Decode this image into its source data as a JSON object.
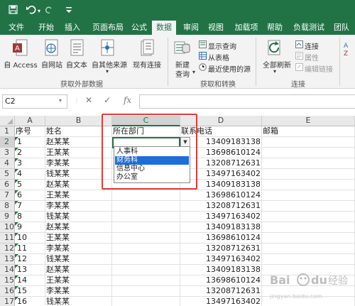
{
  "titlebar": {
    "save_icon": "save-icon",
    "undo_icon": "undo-icon",
    "customize_icon": "customize-qat-icon"
  },
  "tabs": [
    "文件",
    "开始",
    "插入",
    "页面布局",
    "公式",
    "数据",
    "审阅",
    "视图",
    "加载项",
    "帮助",
    "负载测试",
    "团队"
  ],
  "active_tab": "数据",
  "ribbon": {
    "external": {
      "access": "自 Access",
      "web": "自网站",
      "text": "自文本",
      "other": "自其他来源",
      "existing": "现有连接",
      "label": "获取外部数据"
    },
    "transform": {
      "new_query_1": "新建",
      "new_query_2": "查询",
      "show_queries": "显示查询",
      "from_table": "从表格",
      "recent_sources": "最近使用的源",
      "label": "获取和转换"
    },
    "connections": {
      "refresh_all": "全部刷新",
      "connections": "连接",
      "properties": "属性",
      "edit_links": "编辑链接",
      "label": "连接"
    }
  },
  "formula_bar": {
    "name_box": "C2",
    "cancel": "✕",
    "enter": "✓",
    "fx": "fx",
    "value": ""
  },
  "columns": [
    "A",
    "B",
    "C",
    "D",
    "E"
  ],
  "header_row": [
    "序号",
    "姓名",
    "所在部门",
    "联系电话",
    "邮箱"
  ],
  "rows": [
    [
      "1",
      "赵某某",
      "",
      "13409183138",
      ""
    ],
    [
      "2",
      "王某某",
      "",
      "13698610124",
      ""
    ],
    [
      "3",
      "李某某",
      "",
      "13208712631",
      ""
    ],
    [
      "4",
      "钱某某",
      "",
      "13497163402",
      ""
    ],
    [
      "5",
      "赵某某",
      "",
      "13409183138",
      ""
    ],
    [
      "6",
      "王某某",
      "",
      "13698610124",
      ""
    ],
    [
      "7",
      "李某某",
      "",
      "13208712631",
      ""
    ],
    [
      "8",
      "钱某某",
      "",
      "13497163402",
      ""
    ],
    [
      "9",
      "赵某某",
      "",
      "13409183138",
      ""
    ],
    [
      "10",
      "王某某",
      "",
      "13698610124",
      ""
    ],
    [
      "11",
      "李某某",
      "",
      "13208712631",
      ""
    ],
    [
      "12",
      "钱某某",
      "",
      "13497163402",
      ""
    ],
    [
      "13",
      "赵某某",
      "",
      "13409183138",
      ""
    ],
    [
      "14",
      "王某某",
      "",
      "13698610124",
      ""
    ],
    [
      "15",
      "李某某",
      "",
      "13208712631",
      ""
    ],
    [
      "16",
      "钱某某",
      "",
      "13497163402",
      ""
    ]
  ],
  "row_numbers": [
    "1",
    "2",
    "3",
    "4",
    "5",
    "6",
    "7",
    "8",
    "9",
    "10",
    "11",
    "12",
    "13",
    "14",
    "15",
    "16",
    "17"
  ],
  "dropdown": {
    "options": [
      "人事科",
      "财务科",
      "信息中心",
      "办公室"
    ],
    "highlighted": "财务科"
  },
  "colors": {
    "excel_green": "#217346",
    "highlight_blue": "#1e6dd8",
    "annotation_red": "#e23b3b"
  },
  "watermark": "Bai du 经验"
}
